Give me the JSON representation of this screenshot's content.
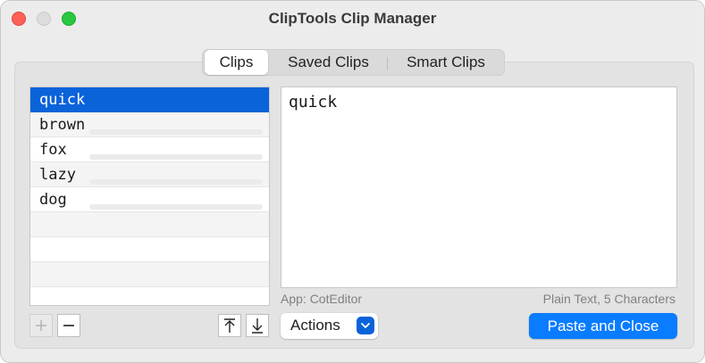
{
  "window": {
    "title": "ClipTools Clip Manager"
  },
  "tabs": [
    {
      "label": "Clips",
      "active": true
    },
    {
      "label": "Saved Clips",
      "active": false
    },
    {
      "label": "Smart Clips",
      "active": false
    }
  ],
  "clips": [
    {
      "text": "quick",
      "selected": true
    },
    {
      "text": "brown",
      "selected": false
    },
    {
      "text": "fox",
      "selected": false
    },
    {
      "text": "lazy",
      "selected": false
    },
    {
      "text": "dog",
      "selected": false
    }
  ],
  "preview": {
    "text": "quick",
    "app_info": "App: CotEditor",
    "type_info": "Plain Text, 5 Characters"
  },
  "controls": {
    "add_icon": "plus-icon",
    "remove_icon": "minus-icon",
    "move_top_icon": "arrow-to-top-icon",
    "move_down_icon": "arrow-down-icon",
    "actions_label": "Actions",
    "paste_label": "Paste and Close"
  },
  "colors": {
    "accent": "#0a63d9",
    "primary_button": "#0a7cff"
  }
}
